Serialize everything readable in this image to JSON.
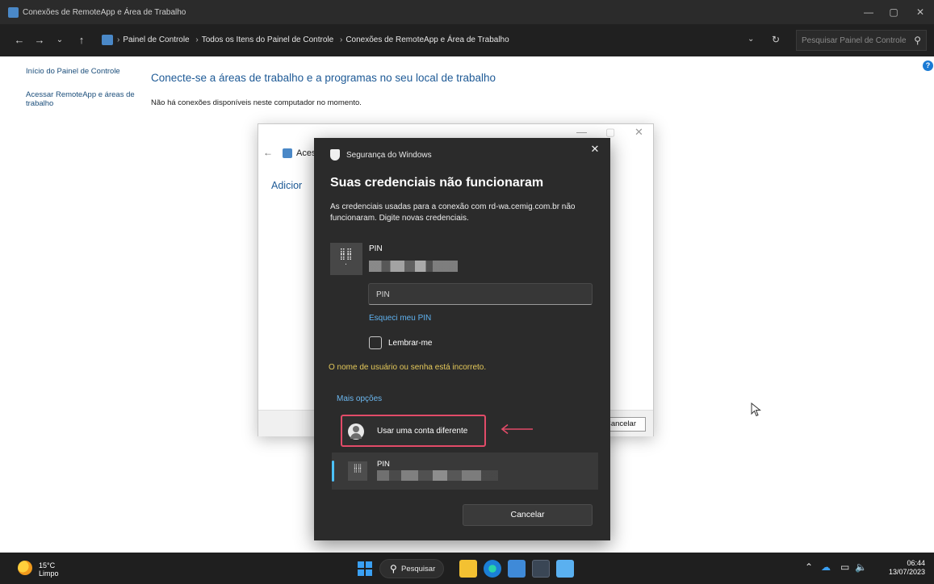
{
  "window": {
    "title": "Conexões de RemoteApp e Área de Trabalho",
    "controls": [
      "—",
      "▢",
      "✕"
    ]
  },
  "address_bar": {
    "breadcrumb": [
      "Painel de Controle",
      "Todos os Itens do Painel de Controle",
      "Conexões de RemoteApp e Área de Trabalho"
    ],
    "search_placeholder": "Pesquisar Painel de Controle"
  },
  "sidebar": {
    "home_link": "Início do Painel de Controle",
    "access_link": "Acessar RemoteApp e áreas de trabalho"
  },
  "main": {
    "heading": "Conecte-se a áreas de trabalho e a programas no seu local de trabalho",
    "no_connections": "Não há conexões disponíveis neste computador no momento."
  },
  "wizard": {
    "title_fragment": "Acess",
    "add_fragment": "Adicior",
    "cancel_fragment": "Cancelar"
  },
  "security_dialog": {
    "app_title": "Segurança do Windows",
    "heading": "Suas credenciais não funcionaram",
    "message": "As credenciais usadas para a conexão com rd-wa.cemig.com.br não funcionaram. Digite novas credenciais.",
    "credential_label": "PIN",
    "pin_placeholder": "PIN",
    "forgot_pin": "Esqueci meu PIN",
    "remember_me": "Lembrar-me",
    "error": "O nome de usuário ou senha está incorreto.",
    "more_options": "Mais opções",
    "use_different_account": "Usar uma conta diferente",
    "alt_credential_label": "PIN",
    "cancel": "Cancelar",
    "highlight_color": "#e24b68",
    "accent_color": "#4cc2ff"
  },
  "taskbar": {
    "temperature": "15°C",
    "weather": "Limpo",
    "search_label": "Pesquisar",
    "time": "06:44",
    "date": "13/07/2023"
  }
}
